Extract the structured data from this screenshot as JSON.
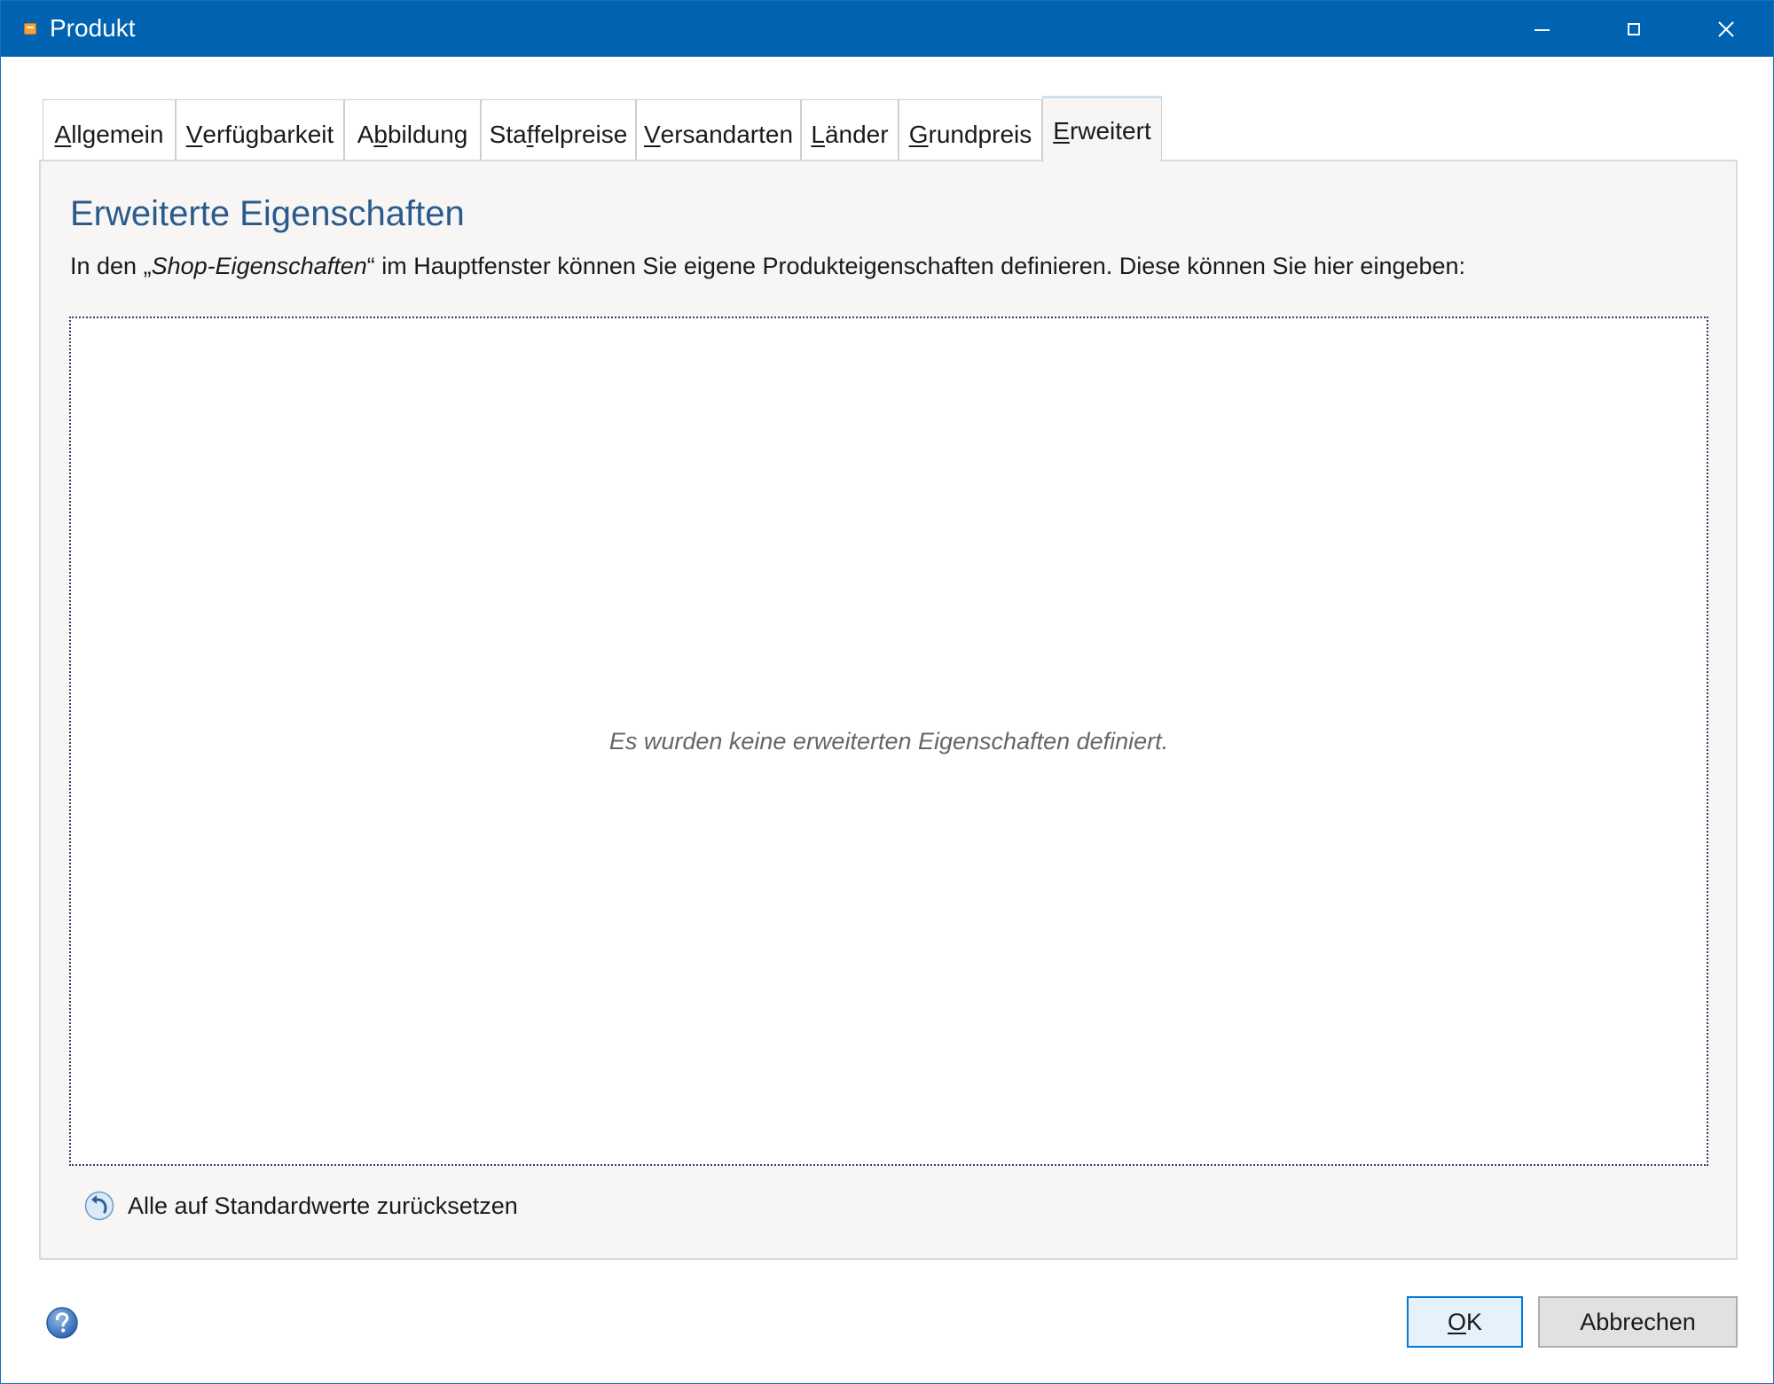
{
  "window": {
    "title": "Produkt",
    "controls": {
      "minimize": "minimize",
      "maximize": "maximize",
      "close": "close"
    }
  },
  "tabs": [
    {
      "accel": "A",
      "rest": "llgemein",
      "pre": ""
    },
    {
      "accel": "V",
      "rest": "erfügbarkeit",
      "pre": ""
    },
    {
      "pre": "A",
      "accel": "b",
      "rest": "bildung"
    },
    {
      "pre": "Sta",
      "accel": "f",
      "rest": "felpreise"
    },
    {
      "accel": "V",
      "rest": "ersandarten",
      "pre": ""
    },
    {
      "accel": "L",
      "rest": "änder",
      "pre": ""
    },
    {
      "accel": "G",
      "rest": "rundpreis",
      "pre": ""
    },
    {
      "accel": "E",
      "rest": "rweitert",
      "pre": ""
    }
  ],
  "active_tab_index": 7,
  "section": {
    "heading": "Erweiterte Eigenschaften",
    "desc_before": "In den „",
    "desc_emph": "Shop-Eigenschaften",
    "desc_after": "“ im Hauptfenster können Sie eigene Produkteigenschaften definieren. Diese können Sie hier eingeben:",
    "empty_message": "Es wurden keine erweiterten Eigenschaften definiert.",
    "reset_label": "Alle auf Standardwerte zurücksetzen"
  },
  "footer": {
    "ok_accel": "O",
    "ok_rest": "K",
    "cancel_label": "Abbrechen"
  },
  "colors": {
    "titlebar": "#0063b1",
    "heading": "#2b5a8c",
    "panel_bg": "#f7f6f5",
    "ok_border": "#0078d7"
  },
  "icons": {
    "app": "product-icon",
    "reset": "undo-arrow-icon",
    "help": "help-question-icon"
  }
}
